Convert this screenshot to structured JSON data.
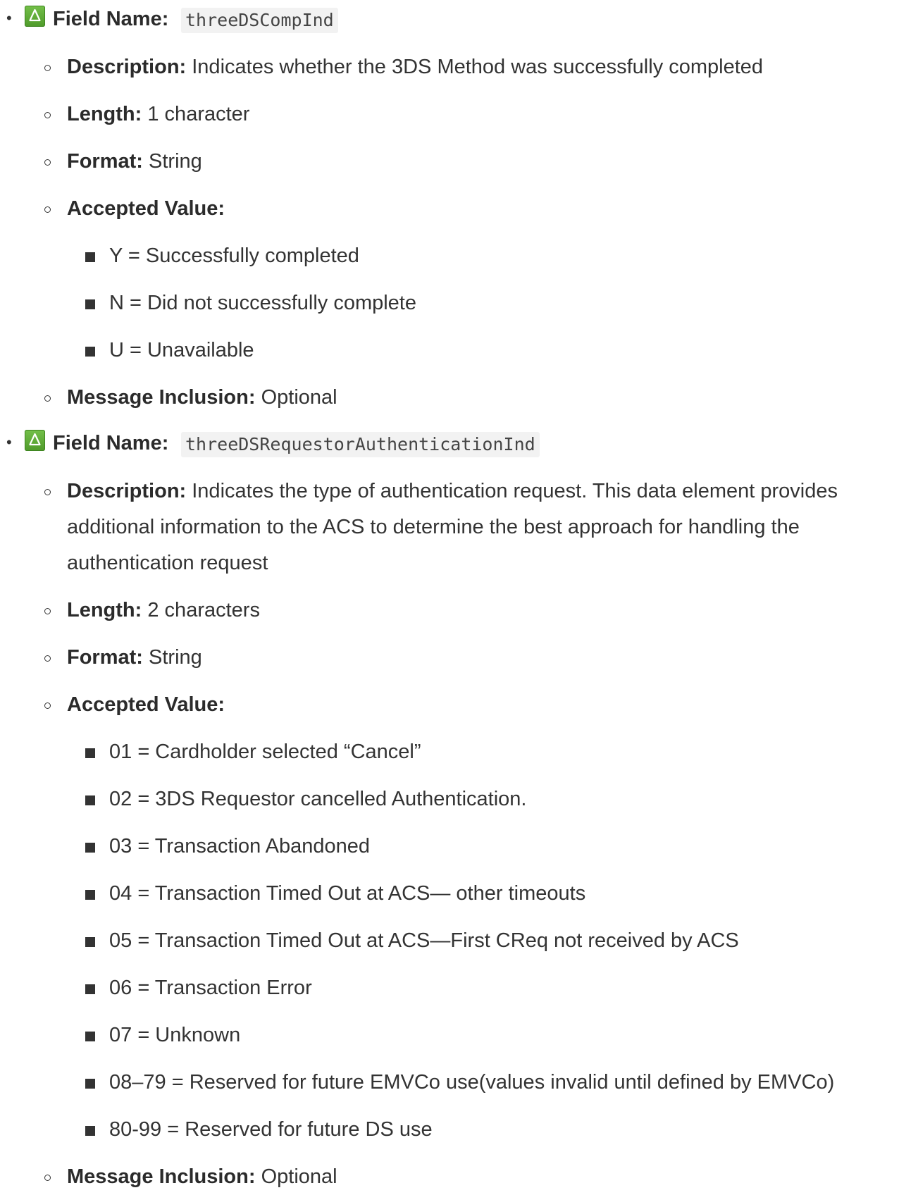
{
  "fields": [
    {
      "label": "Field Name:",
      "code": "threeDSCompInd",
      "description_key": "Description:",
      "description": "Indicates whether the 3DS Method was successfully completed",
      "length_key": "Length:",
      "length": "1 character",
      "format_key": "Format:",
      "format": "String",
      "accepted_key": "Accepted Value:",
      "accepted": [
        "Y = Successfully completed",
        "N = Did not successfully complete",
        "U = Unavailable"
      ],
      "inclusion_key": "Message Inclusion:",
      "inclusion": "Optional"
    },
    {
      "label": "Field Name:",
      "code": "threeDSRequestorAuthenticationInd",
      "description_key": "Description:",
      "description": "Indicates the type of authentication request. This data element provides additional information to the ACS to determine the best approach for handling the authentication request",
      "length_key": "Length:",
      "length": "2 characters",
      "format_key": "Format:",
      "format": "String",
      "accepted_key": "Accepted Value:",
      "accepted": [
        "01 = Cardholder selected “Cancel”",
        "02 = 3DS Requestor cancelled Authentication.",
        "03 = Transaction Abandoned",
        "04 = Transaction Timed Out at ACS— other timeouts",
        "05 = Transaction Timed Out at ACS—First CReq not received by ACS",
        "06 = Transaction Error",
        "07 = Unknown",
        "08–79 = Reserved for future EMVCo use(values invalid until defined by EMVCo)",
        "80-99 = Reserved for future DS use"
      ],
      "inclusion_key": "Message Inclusion:",
      "inclusion": "Optional"
    }
  ]
}
